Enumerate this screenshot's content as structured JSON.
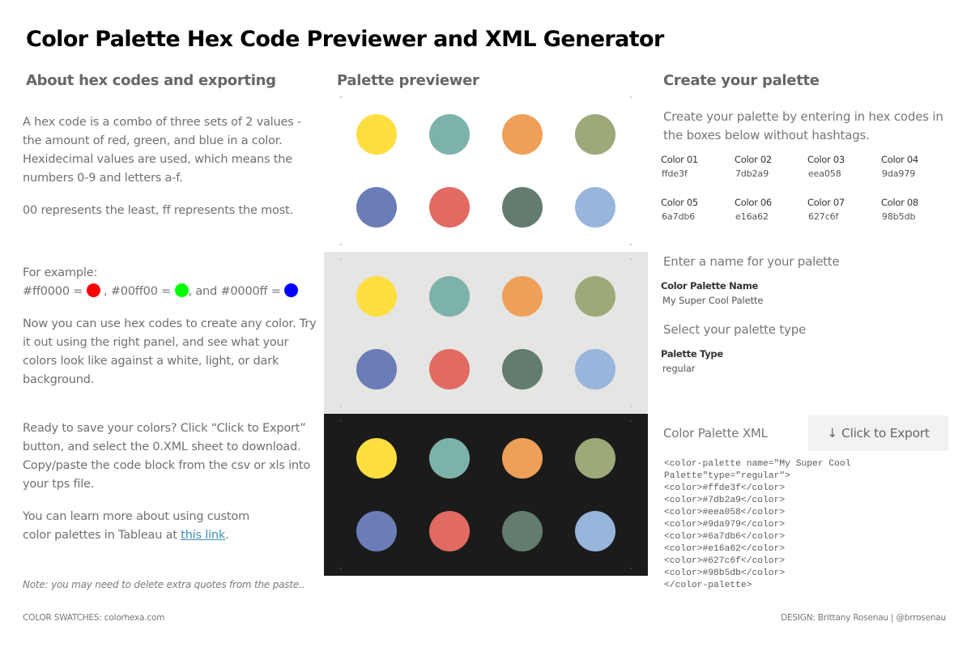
{
  "title": "Color Palette Hex Code Previewer and XML Generator",
  "sections": {
    "about": "About hex codes and exporting",
    "preview": "Palette previewer",
    "create": "Create your palette"
  },
  "about": {
    "p1": "A hex code is a combo of three sets of 2 values - the amount of red, green, and blue in a color. Hexidecimal values are used, which means the numbers 0-9 and letters a-f.",
    "p2": "00 represents the least, ff represents the most.",
    "example_intro": "For example:",
    "examples": [
      {
        "code": "#ff0000 = ",
        "color": "#ff0000",
        "after": " , "
      },
      {
        "code": "#00ff00 = ",
        "color": "#00ff00",
        "after": ", and "
      },
      {
        "code": "#0000ff = ",
        "color": "#0000ff",
        "after": ""
      }
    ],
    "p3": "Now you can use hex codes to create any color. Try it out using the right panel, and see what your colors look like against a white, light, or dark background.",
    "p4a": "Ready to save your colors? Click  “Click to Export” button, and select the 0.XML sheet to download.",
    "p4b": "Copy/paste the code block from the csv or xls into your tps file.",
    "p5_before": "You can learn more about using custom color palettes in Tableau at ",
    "p5_link": "this link",
    "p5_after": ".",
    "note": "Note: you may need to delete extra quotes from the paste.."
  },
  "preview": {
    "backgrounds": [
      {
        "name": "white",
        "color": "#ffffff"
      },
      {
        "name": "light",
        "color": "#e5e5e3"
      },
      {
        "name": "dark",
        "color": "#1b1b1b"
      }
    ]
  },
  "create": {
    "description": "Create your palette by entering in hex codes in the boxes below without hashtags.",
    "colors": [
      {
        "label": "Color 01",
        "value": "ffde3f"
      },
      {
        "label": "Color 02",
        "value": "7db2a9"
      },
      {
        "label": "Color 03",
        "value": "eea058"
      },
      {
        "label": "Color 04",
        "value": "9da979"
      },
      {
        "label": "Color 05",
        "value": "6a7db6"
      },
      {
        "label": "Color 06",
        "value": "e16a62"
      },
      {
        "label": "Color 07",
        "value": "627c6f"
      },
      {
        "label": "Color 08",
        "value": "98b5db"
      }
    ],
    "name_heading": "Enter a name for your palette",
    "name_label": "Color Palette Name",
    "name_value": "My Super Cool Palette",
    "type_heading": "Select your palette type",
    "type_label": "Palette Type",
    "type_value": "regular",
    "xml_heading": "Color Palette XML",
    "export_label": "Click to Export",
    "export_icon": "arrow-down-icon",
    "xml_lines": [
      "<color-palette name=\"My Super Cool",
      "Palette\"type=\"regular\">",
      "<color>#ffde3f</color>",
      "<color>#7db2a9</color>",
      "<color>#eea058</color>",
      "<color>#9da979</color>",
      "<color>#6a7db6</color>",
      "<color>#e16a62</color>",
      "<color>#627c6f</color>",
      "<color>#98b5db</color>",
      "</color-palette>"
    ]
  },
  "footer": {
    "left": "COLOR SWATCHES: colorhexa.com",
    "right": "DESIGN: Brittany Rosenau | @brrosenau"
  }
}
